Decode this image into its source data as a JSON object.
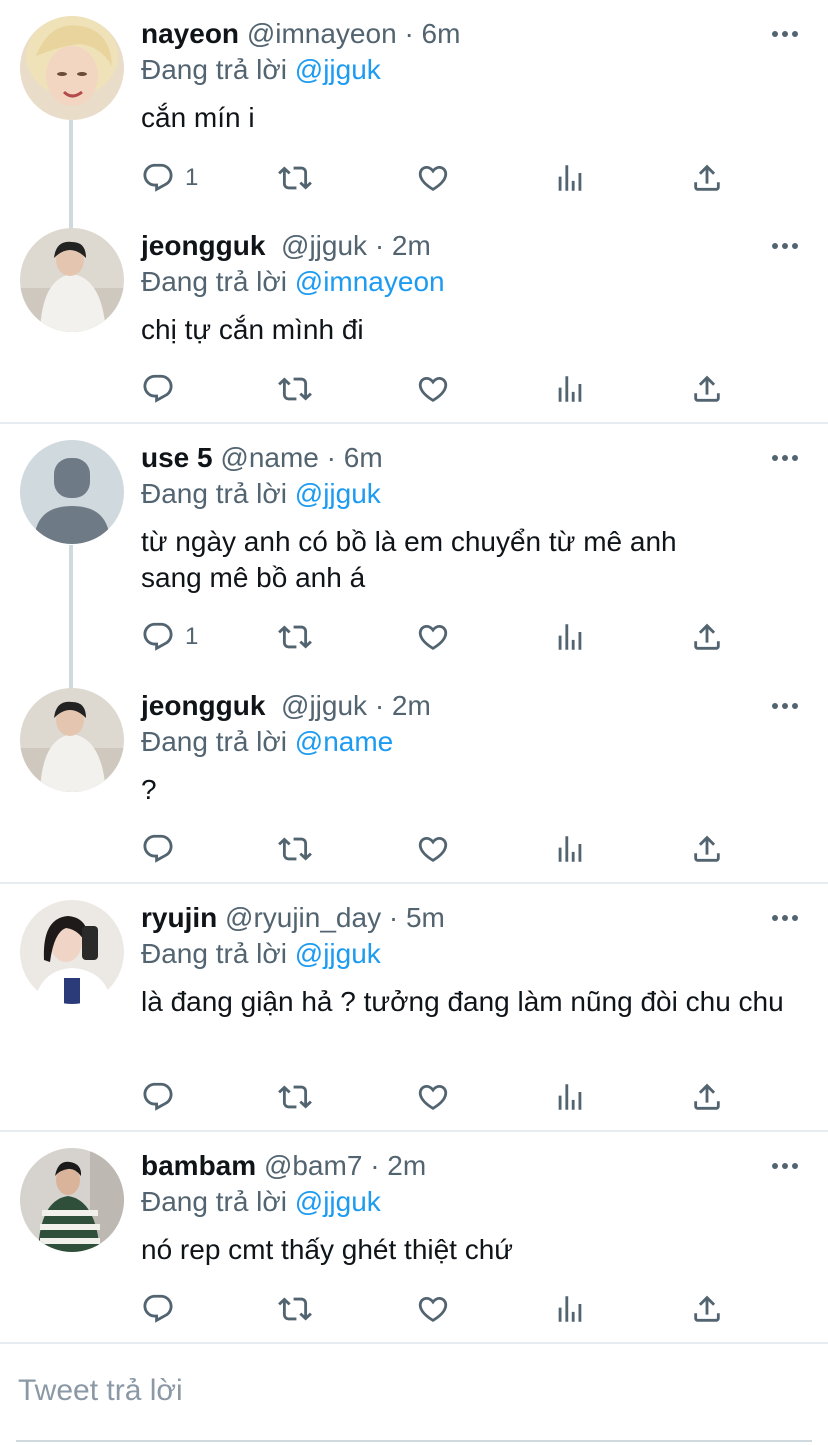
{
  "tweets": [
    {
      "name": "nayeon",
      "handle": "@imnayeon",
      "dot": "·",
      "time": "6m",
      "replying_prefix": "Đang trả lời",
      "replying_to": "@jjguk",
      "text": "cắn mín i",
      "reply_count": "1"
    },
    {
      "name": "jeongguk",
      "handle": "@jjguk",
      "dot": "·",
      "time": "2m",
      "replying_prefix": "Đang trả lời",
      "replying_to": "@imnayeon",
      "text": "chị tự cắn mình đi",
      "reply_count": ""
    },
    {
      "name": "use 5",
      "handle": "@name",
      "dot": "·",
      "time": "6m",
      "replying_prefix": "Đang trả lời",
      "replying_to": "@jjguk",
      "text": "từ ngày anh có bồ là em chuyển từ mê anh sang mê bồ anh á",
      "reply_count": "1"
    },
    {
      "name": "jeongguk",
      "handle": "@jjguk",
      "dot": "·",
      "time": "2m",
      "replying_prefix": "Đang trả lời",
      "replying_to": "@name",
      "text": "?",
      "reply_count": ""
    },
    {
      "name": "ryujin",
      "handle": "@ryujin_day",
      "dot": "·",
      "time": "5m",
      "replying_prefix": "Đang trả lời",
      "replying_to": "@jjguk",
      "text": "là đang giận hả ? tưởng đang làm nũng đòi chu chu",
      "reply_count": ""
    },
    {
      "name": "bambam",
      "handle": "@bam7",
      "dot": "·",
      "time": "2m",
      "replying_prefix": "Đang trả lời",
      "replying_to": "@jjguk",
      "text": "nó rep cmt thấy ghét thiệt chứ",
      "reply_count": ""
    }
  ],
  "compose": {
    "placeholder": "Tweet trả lời"
  },
  "colors": {
    "accent": "#1d9bf0",
    "secondary": "#536471",
    "divider": "#e6ecf0"
  },
  "icons": [
    "reply-icon",
    "retweet-icon",
    "like-icon",
    "analytics-icon",
    "share-icon",
    "more-icon"
  ]
}
